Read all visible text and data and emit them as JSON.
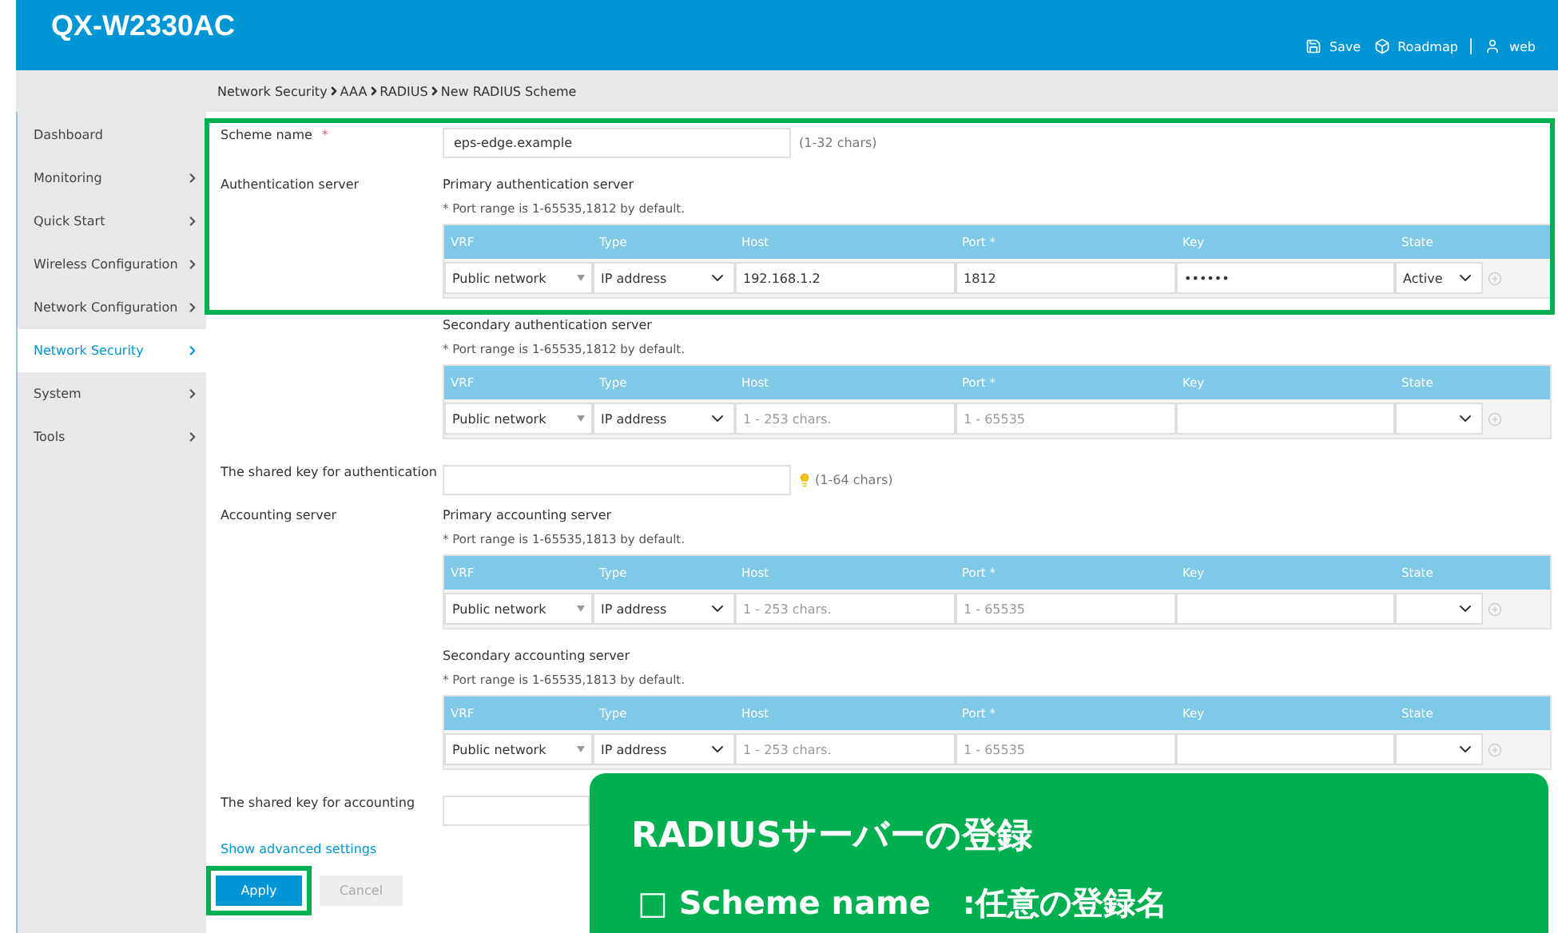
{
  "header": {
    "title": "QX-W2330AC",
    "actions": [
      {
        "kind": "save",
        "label": "Save"
      },
      {
        "kind": "roadmap",
        "label": "Roadmap"
      },
      {
        "kind": "user",
        "label": "web"
      }
    ]
  },
  "breadcrumb": [
    "Network Security",
    "AAA",
    "RADIUS",
    "New RADIUS Scheme"
  ],
  "sidebar": {
    "items": [
      {
        "label": "Dashboard",
        "has_arrow": false,
        "selected": false
      },
      {
        "label": "Monitoring",
        "has_arrow": true,
        "selected": false
      },
      {
        "label": "Quick Start",
        "has_arrow": true,
        "selected": false
      },
      {
        "label": "Wireless Configuration",
        "has_arrow": true,
        "selected": false
      },
      {
        "label": "Network Configuration",
        "has_arrow": true,
        "selected": false
      },
      {
        "label": "Network Security",
        "has_arrow": true,
        "selected": true
      },
      {
        "label": "System",
        "has_arrow": true,
        "selected": false
      },
      {
        "label": "Tools",
        "has_arrow": true,
        "selected": false
      }
    ]
  },
  "scheme_name": {
    "label": "Scheme name",
    "required": true,
    "required_mark": "*",
    "value": "eps-edge.example",
    "hint": "(1-32 chars)"
  },
  "server_groups": [
    {
      "label": "Authentication server",
      "servers": [
        {
          "title": "Primary authentication server",
          "note": "* Port range is 1-65535,1812 by default.",
          "columns": [
            "VRF",
            "Type",
            "Host",
            "Port *",
            "Key",
            "State"
          ],
          "row": {
            "vrf": "Public network",
            "type": "IP address",
            "host": {
              "value": "192.168.1.2"
            },
            "port": {
              "value": "1812"
            },
            "key": {
              "value": "••••••"
            },
            "state": "Active"
          }
        },
        {
          "title": "Secondary authentication server",
          "note": "* Port range is 1-65535,1812 by default.",
          "columns": [
            "VRF",
            "Type",
            "Host",
            "Port *",
            "Key",
            "State"
          ],
          "row": {
            "vrf": "Public network",
            "type": "IP address",
            "host": {
              "placeholder": "1 - 253 chars."
            },
            "port": {
              "placeholder": "1 - 65535"
            }
          }
        }
      ],
      "shared_key": {
        "label": "The shared key for authentication",
        "hint": "(1-64 chars)"
      }
    },
    {
      "label": "Accounting server",
      "servers": [
        {
          "title": "Primary accounting server",
          "note": "* Port range is 1-65535,1813 by default.",
          "columns": [
            "VRF",
            "Type",
            "Host",
            "Port *",
            "Key",
            "State"
          ],
          "row": {
            "vrf": "Public network",
            "type": "IP address",
            "host": {
              "placeholder": "1 - 253 chars."
            },
            "port": {
              "placeholder": "1 - 65535"
            }
          }
        },
        {
          "title": "Secondary accounting server",
          "note": "* Port range is 1-65535,1813 by default.",
          "columns": [
            "VRF",
            "Type",
            "Host",
            "Port *",
            "Key",
            "State"
          ],
          "row": {
            "vrf": "Public network",
            "type": "IP address",
            "host": {
              "placeholder": "1 - 253 chars."
            },
            "port": {
              "placeholder": "1 - 65535"
            }
          }
        }
      ],
      "shared_key": {
        "label": "The shared key for accounting"
      }
    }
  ],
  "advanced_link": "Show advanced settings",
  "buttons": [
    {
      "label": "Apply",
      "primary": true
    },
    {
      "label": "Cancel",
      "primary": false
    }
  ],
  "callout": {
    "title": "RADIUSサーバーの登録",
    "lines": [
      "□ Scheme name　:任意の登録名"
    ]
  }
}
